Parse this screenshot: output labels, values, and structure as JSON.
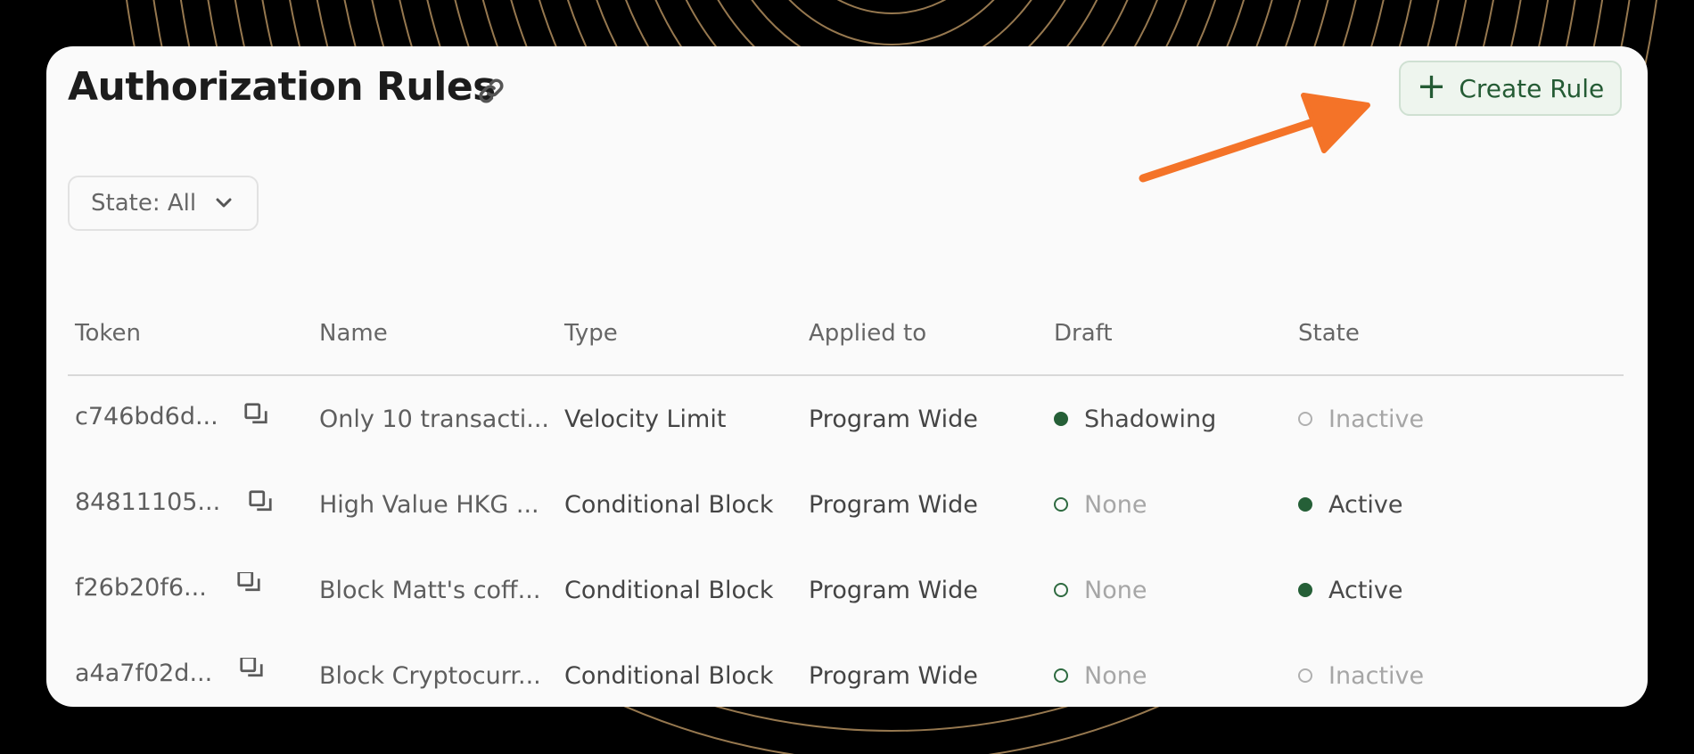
{
  "page": {
    "title": "Authorization Rules",
    "create_button": "Create Rule",
    "filter_label": "State: All"
  },
  "table": {
    "headers": [
      "Token",
      "Name",
      "Type",
      "Applied to",
      "Draft",
      "State"
    ],
    "rows": [
      {
        "token": "c746bd6d...",
        "name": "Only 10 transacti...",
        "type": "Velocity Limit",
        "applied_to": "Program Wide",
        "draft": "Shadowing",
        "draft_style": "filled",
        "state": "Inactive",
        "state_style": "inactive"
      },
      {
        "token": "84811105...",
        "name": "High Value HKG ...",
        "type": "Conditional Block",
        "applied_to": "Program Wide",
        "draft": "None",
        "draft_style": "hollow",
        "state": "Active",
        "state_style": "active"
      },
      {
        "token": "f26b20f6...",
        "name": "Block Matt's coff...",
        "type": "Conditional Block",
        "applied_to": "Program Wide",
        "draft": "None",
        "draft_style": "hollow",
        "state": "Active",
        "state_style": "active"
      },
      {
        "token": "a4a7f02d...",
        "name": "Block Cryptocurr...",
        "type": "Conditional Block",
        "applied_to": "Program Wide",
        "draft": "None",
        "draft_style": "hollow",
        "state": "Inactive",
        "state_style": "inactive"
      }
    ]
  },
  "icons": {
    "link": "link-icon",
    "copy": "copy-icon",
    "plus": "plus-icon",
    "chevron": "chevron-down-icon",
    "annotation": "arrow-annotation"
  },
  "colors": {
    "background": "#000000",
    "card": "#fafafa",
    "accent_green": "#255f37",
    "arrow": "#f47328",
    "pattern": "#c9a06a"
  }
}
